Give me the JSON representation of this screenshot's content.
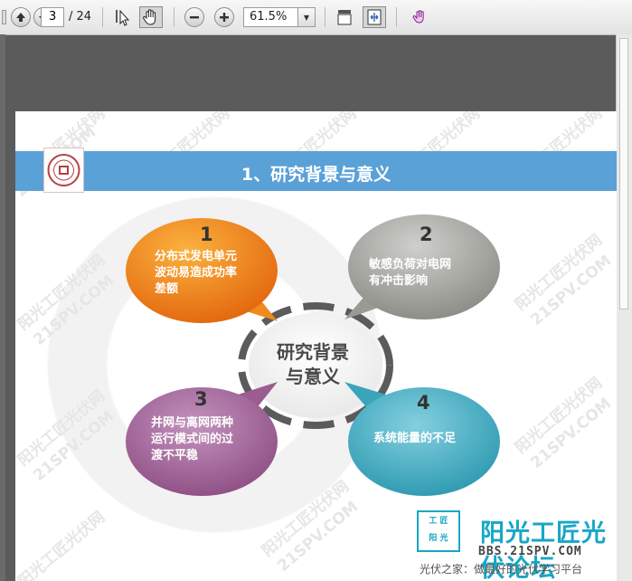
{
  "toolbar": {
    "page_current": "3",
    "page_total": "/ 24",
    "zoom": "61.5%"
  },
  "slide": {
    "title": "1、研究背景与意义",
    "center": [
      "研究背景",
      "与意义"
    ],
    "items": [
      {
        "num": "1",
        "lines": [
          "分布式发电单元",
          "波动易造成功率",
          "差额"
        ],
        "color": "#f28a16"
      },
      {
        "num": "2",
        "lines": [
          "敏感负荷对电网",
          "有冲击影响"
        ],
        "color": "#9b9b96"
      },
      {
        "num": "3",
        "lines": [
          "并网与离网两种",
          "运行模式间的过",
          "渡不平稳"
        ],
        "color": "#9f5d93"
      },
      {
        "num": "4",
        "lines": [
          "系统能量的不足"
        ],
        "color": "#3ea8bd"
      }
    ],
    "watermark": [
      "阳光工匠光伏网",
      "21SPV.COM"
    ],
    "brand": {
      "stamp": [
        "工 匠",
        "阳 光"
      ],
      "name": "阳光工匠光伏论坛",
      "url": "BBS.21SPV.COM",
      "slogan": "光伏之家：做最好的光伏学习平台"
    }
  }
}
